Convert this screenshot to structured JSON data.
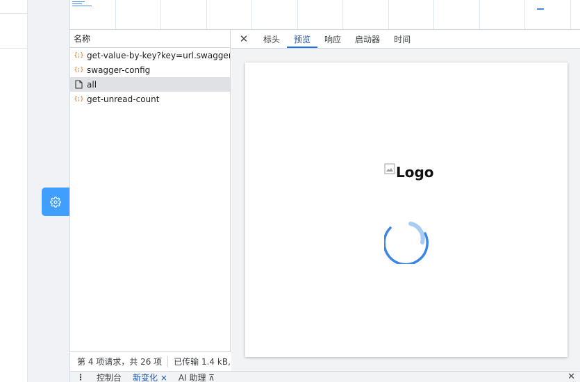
{
  "request_list": {
    "header": "名称",
    "requests": [
      {
        "name": "get-value-by-key?key=url.swagger",
        "icon": "json-icon",
        "selected": false
      },
      {
        "name": "swagger-config",
        "icon": "json-icon",
        "selected": false
      },
      {
        "name": "all",
        "icon": "document-icon",
        "selected": true
      },
      {
        "name": "get-unread-count",
        "icon": "json-icon",
        "selected": false
      }
    ],
    "status": {
      "count_text": "第 4 项请求，共 26 项",
      "transfer_text": "已传输 1.4 kB,"
    }
  },
  "detail_tabs": {
    "close_icon": "close-icon",
    "items": [
      "标头",
      "预览",
      "响应",
      "启动器",
      "时间"
    ],
    "active": "预览"
  },
  "preview": {
    "logo_alt": "Logo",
    "broken_image_icon": "broken-image-icon",
    "spinner_icon": "loading-spinner-icon"
  },
  "drawer": {
    "menu_icon": "kebab-menu-icon",
    "tabs": [
      "控制台",
      "新变化 ×",
      "AI 助理 ⊼"
    ],
    "active": "新变化 ×",
    "close_icon": "close-icon"
  },
  "left_app": {
    "settings_icon": "gear-icon",
    "accent": "#409eff"
  },
  "colors": {
    "accent": "#1a73e8",
    "selected_row": "#dfe1e5",
    "json_icon": "#e8710a"
  }
}
